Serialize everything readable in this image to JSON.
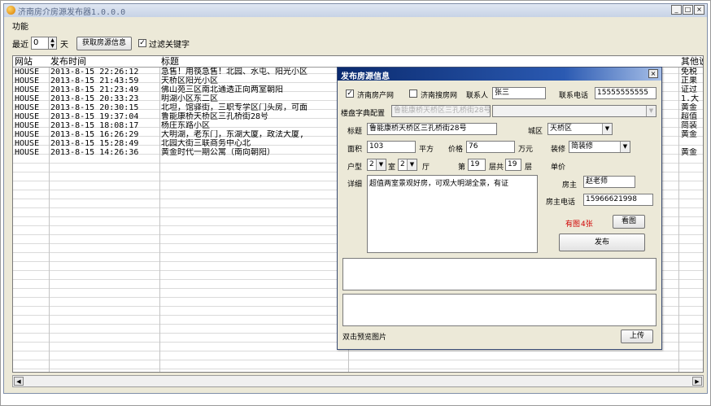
{
  "app": {
    "title": "济南房介房源发布器1.0.0.0",
    "menu_label": "功能",
    "window_buttons": {
      "minimize": "_",
      "maximize": "□",
      "close": "×"
    }
  },
  "toolbar": {
    "recent_label": "最近",
    "days_value": "0",
    "days_unit": "天",
    "fetch_button": "获取房源信息",
    "filter_checked": true,
    "filter_label": "过滤关键字"
  },
  "grid": {
    "columns": [
      "网站",
      "发布时间",
      "标题",
      "其他说"
    ],
    "rows": [
      {
        "site": "HOUSE",
        "time": "2013-8-15 22:26:12",
        "title": "急售！用筷急售！北园、水屯、阳光小区",
        "other": "免税"
      },
      {
        "site": "HOUSE",
        "time": "2013-8-15 21:43:59",
        "title": "天桥区阳光小区",
        "other": "正果"
      },
      {
        "site": "HOUSE",
        "time": "2013-8-15 21:23:49",
        "title": "佛山苑三区南北通透正向两室朝阳",
        "other": "证过"
      },
      {
        "site": "HOUSE",
        "time": "2013-8-15 20:33:23",
        "title": "明湖小区东二区",
        "other": "1.大"
      },
      {
        "site": "HOUSE",
        "time": "2013-8-15 20:30:15",
        "title": "北坦，馆驿街，三职专学区门头房，可面",
        "other": "黄金"
      },
      {
        "site": "HOUSE",
        "time": "2013-8-15 19:37:04",
        "title": "鲁能康桥天桥区三孔桥街28号",
        "other": "超值"
      },
      {
        "site": "HOUSE",
        "time": "2013-8-15 18:08:17",
        "title": "杨庄东路小区",
        "other": "简装"
      },
      {
        "site": "HOUSE",
        "time": "2013-8-15 16:26:29",
        "title": "大明湖，老东门，东湖大厦，政法大厦,",
        "other": "黄金"
      },
      {
        "site": "HOUSE",
        "time": "2013-8-15 15:28:49",
        "title": "北园大街三联商务中心北",
        "other": ""
      },
      {
        "site": "HOUSE",
        "time": "2013-8-15 14:26:36",
        "title": "黄金时代一期公寓（南向朝阳）",
        "other": "黄金"
      }
    ]
  },
  "dialog": {
    "title": "发布房源信息",
    "close": "×",
    "site1_label": "济南房产网",
    "site1_checked": true,
    "site2_label": "济南搜房网",
    "site2_checked": false,
    "contact_label": "联系人",
    "contact_value": "张三",
    "phone_label": "联系电话",
    "phone_value": "15555555555",
    "config_label": "楼盘字典配置",
    "config_value": "鲁能康桥天桥区三孔桥街28号",
    "title_label": "标题",
    "title_value": "鲁能康桥天桥区三孔桥街28号",
    "district_label": "城区",
    "district_value": "天桥区",
    "area_label": "面积",
    "area_value": "103",
    "area_unit": "平方",
    "price_label": "价格",
    "price_value": "76",
    "price_unit": "万元",
    "decor_label": "装修",
    "decor_value": "简装修",
    "layout_label": "户型",
    "rooms_value": "2",
    "rooms_unit": "室",
    "halls_value": "2",
    "halls_unit": "厅",
    "floor_prefix": "第",
    "floor_value": "19",
    "floor_total_label": "层共",
    "floor_total_value": "19",
    "floor_unit": "层",
    "unit_price_label": "单价",
    "detail_label": "详细",
    "detail_value": "超值两室景观好房，可观大明湖全景，有证",
    "owner_label": "房主",
    "owner_value": "赵老师",
    "owner_phone_label": "房主电话",
    "owner_phone_value": "15966621998",
    "images_prefix": "有图",
    "images_count": "4张",
    "view_images_button": "看图",
    "publish_button": "发布",
    "preview_hint": "双击预览图片",
    "upload_button": "上传"
  }
}
